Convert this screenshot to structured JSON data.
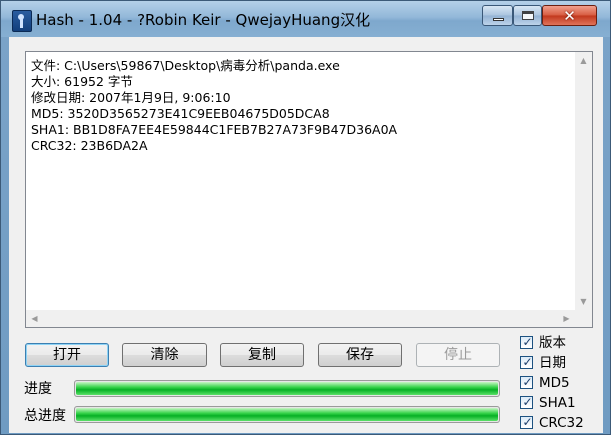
{
  "window": {
    "title": "Hash - 1.04 - ?Robin Keir - QwejayHuang汉化",
    "controls": {
      "minimize_icon": "minimize-icon",
      "maximize_icon": "maximize-icon",
      "close_glyph": "✕"
    }
  },
  "output": {
    "lines": [
      "文件: C:\\Users\\59867\\Desktop\\病毒分析\\panda.exe",
      "大小: 61952 字节",
      "修改日期: 2007年1月9日, 9:06:10",
      "MD5: 3520D3565273E41C9EEB04675D05DCA8",
      "SHA1: BB1D8FA7EE4E59844C1FEB7B27A73F9B47D36A0A",
      "CRC32: 23B6DA2A"
    ]
  },
  "buttons": {
    "open": "打开",
    "clear": "清除",
    "copy": "复制",
    "save": "保存",
    "stop": "停止"
  },
  "progress": {
    "current_label": "进度",
    "current_value": 1.0,
    "total_label": "总进度",
    "total_value": 1.0
  },
  "options": [
    {
      "label": "版本",
      "checked": true
    },
    {
      "label": "日期",
      "checked": true
    },
    {
      "label": "MD5",
      "checked": true
    },
    {
      "label": "SHA1",
      "checked": true
    },
    {
      "label": "CRC32",
      "checked": true
    }
  ],
  "colors": {
    "progress_green": "#06b025",
    "accent": "#3c7fb1"
  }
}
